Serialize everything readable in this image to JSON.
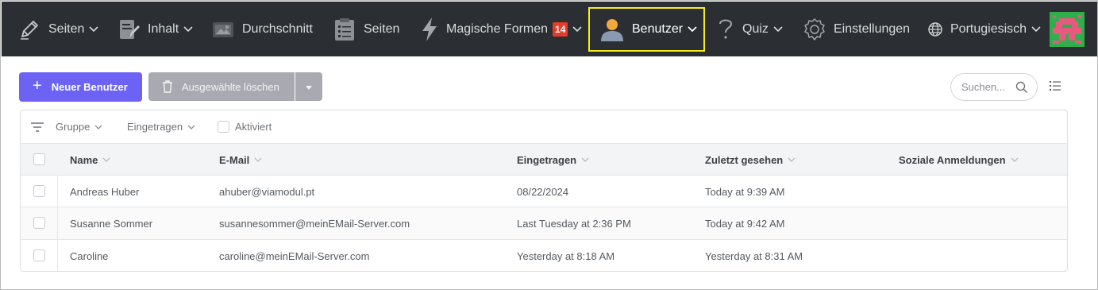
{
  "topbar": {
    "items": [
      {
        "label": "Seiten",
        "icon": "pencil-icon",
        "dropdown": true
      },
      {
        "label": "Inhalt",
        "icon": "content-icon",
        "dropdown": true
      },
      {
        "label": "Durchschnitt",
        "icon": "media-icon",
        "dropdown": false
      },
      {
        "label": "Seiten",
        "icon": "clipboard-icon",
        "dropdown": false
      },
      {
        "label": "Magische Formen",
        "icon": "lightning-icon",
        "dropdown": true,
        "badge": "14"
      },
      {
        "label": "Benutzer",
        "icon": "user-icon",
        "dropdown": true,
        "active": true
      },
      {
        "label": "Quiz",
        "icon": "question-icon",
        "dropdown": true
      },
      {
        "label": "Einstellungen",
        "icon": "gear-icon",
        "dropdown": false
      },
      {
        "label": "Portugiesisch",
        "icon": "globe-icon",
        "dropdown": true
      }
    ],
    "highlight_color": "#f5ee1c",
    "background": "#2b2f33"
  },
  "toolbar": {
    "new_user_label": "Neuer Benutzer",
    "delete_selected_label": "Ausgewählte löschen",
    "search_placeholder": "Suchen...",
    "accent": "#6c63f5"
  },
  "filters": {
    "group_label": "Gruppe",
    "registered_label": "Eingetragen",
    "activated_label": "Aktiviert"
  },
  "table": {
    "columns": [
      "Name",
      "E-Mail",
      "Eingetragen",
      "Zuletzt gesehen",
      "Soziale Anmeldungen"
    ],
    "rows": [
      {
        "name": "Andreas Huber",
        "email": "ahuber@viamodul.pt",
        "registered": "08/22/2024",
        "last_seen": "Today at 9:39 AM",
        "social": ""
      },
      {
        "name": "Susanne Sommer",
        "email": "susannesommer@meinEMail-Server.com",
        "registered": "Last Tuesday at 2:36 PM",
        "last_seen": "Today at 9:42 AM",
        "social": ""
      },
      {
        "name": "Caroline",
        "email": "caroline@meinEMail-Server.com",
        "registered": "Yesterday at 8:18 AM",
        "last_seen": "Yesterday at 8:31 AM",
        "social": ""
      }
    ]
  }
}
